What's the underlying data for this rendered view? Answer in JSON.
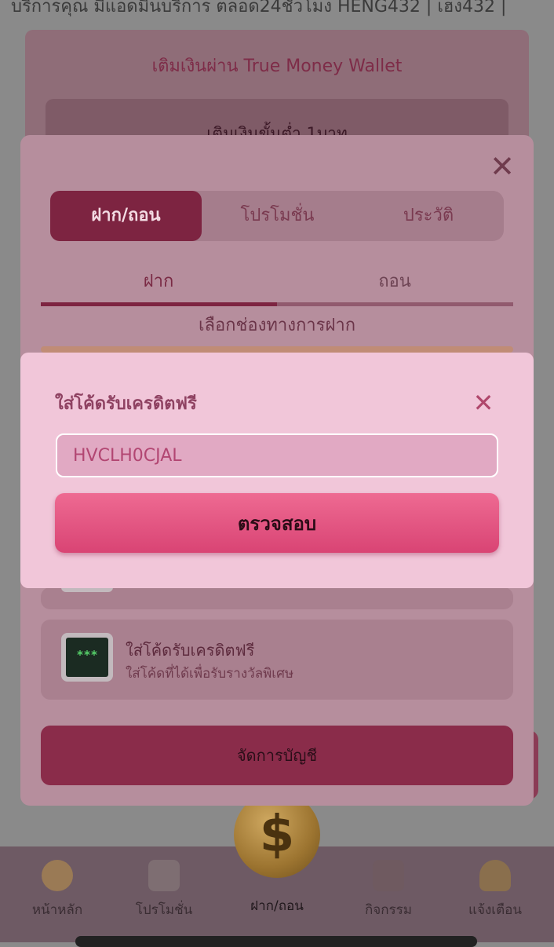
{
  "ticker": {
    "text": "บริการคุณ มีแอดมินบริการ ตลอด24ชั่วโมง  HENG432 | เฮง432 |"
  },
  "base_card": {
    "title": "เติมเงินผ่าน True Money Wallet",
    "min_text": "เติมเงินขั้นต่ำ 1บาท"
  },
  "panel": {
    "tabs": [
      {
        "label": "ฝาก/ถอน",
        "active": true
      },
      {
        "label": "โปรโมชั่น",
        "active": false
      },
      {
        "label": "ประวัติ",
        "active": false
      }
    ],
    "sub_tabs": [
      {
        "label": "ฝาก",
        "active": true
      },
      {
        "label": "ถอน",
        "active": false
      }
    ],
    "choose_label": "เลือกช่องทางการฝาก",
    "free_credit_option": {
      "icon": "terminal-icon",
      "icon_text": "***",
      "title": "ใส่โค้ดรับเครดิตฟรี",
      "subtitle": "ใส่โค้ดที่ได้เพื่อรับรางวัลพิเศษ"
    },
    "manage_button": "จัดการบัญชี"
  },
  "modal": {
    "title": "ใส่โค้ดรับเครดิตฟรี",
    "code_value": "HVCLH0CJAL",
    "verify_button": "ตรวจสอบ"
  },
  "bottom_nav": {
    "coin_symbol": "$",
    "items": [
      {
        "label": "หน้าหลัก",
        "icon": "coins-icon"
      },
      {
        "label": "โปรโมชั่น",
        "icon": "megaphone-icon"
      },
      {
        "label": "ฝาก/ถอน",
        "icon": "coin-icon",
        "active": true
      },
      {
        "label": "กิจกรรม",
        "icon": "calendar-icon"
      },
      {
        "label": "แจ้งเตือน",
        "icon": "bell-icon"
      }
    ]
  },
  "colors": {
    "accent": "#7d2441",
    "modal_bg": "#f1c6d9",
    "verify_button": "#e35a85"
  }
}
